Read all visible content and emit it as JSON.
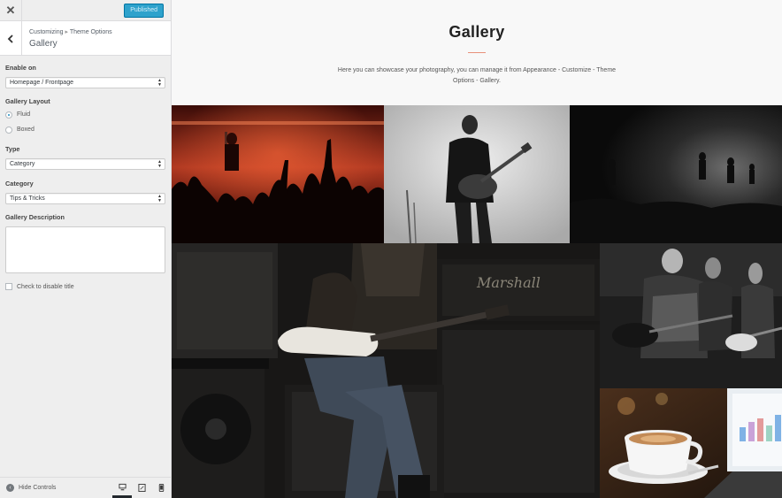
{
  "topbar": {
    "close_icon": "close-icon",
    "publish_label": "Published"
  },
  "section": {
    "breadcrumb_root": "Customizing",
    "breadcrumb_sep": "▸",
    "breadcrumb_parent": "Theme Options",
    "title": "Gallery"
  },
  "controls": {
    "enable_on": {
      "label": "Enable on",
      "value": "Homepage / Frontpage"
    },
    "layout": {
      "label": "Gallery Layout",
      "options": [
        "Fluid",
        "Boxed"
      ],
      "selected": "Fluid"
    },
    "type": {
      "label": "Type",
      "value": "Category"
    },
    "category": {
      "label": "Category",
      "value": "Tips & Tricks"
    },
    "description": {
      "label": "Gallery Description",
      "value": ""
    },
    "disable_title": {
      "label": "Check to disable title",
      "checked": false
    }
  },
  "footer": {
    "hide_label": "Hide Controls",
    "devices": [
      "desktop-icon",
      "tablet-icon",
      "mobile-icon"
    ],
    "active_device": "desktop"
  },
  "preview": {
    "title": "Gallery",
    "description": "Here you can showcase your photography, you can manage it from Appearance - Customize - Theme Options - Gallery.",
    "accent_color": "#e8917a",
    "images": [
      "concert-crowd-red-stage",
      "guitarist-white-backdrop",
      "dark-stage-silhouettes",
      "guitarist-on-amplifiers",
      "band-playing-guitars",
      "coffee-cup-laptop"
    ],
    "amp_brand": "Marshall"
  },
  "colors": {
    "publish_bg": "#2ea2cc",
    "sidebar_bg": "#eeeeee",
    "header_bg": "#f8f8f8"
  }
}
